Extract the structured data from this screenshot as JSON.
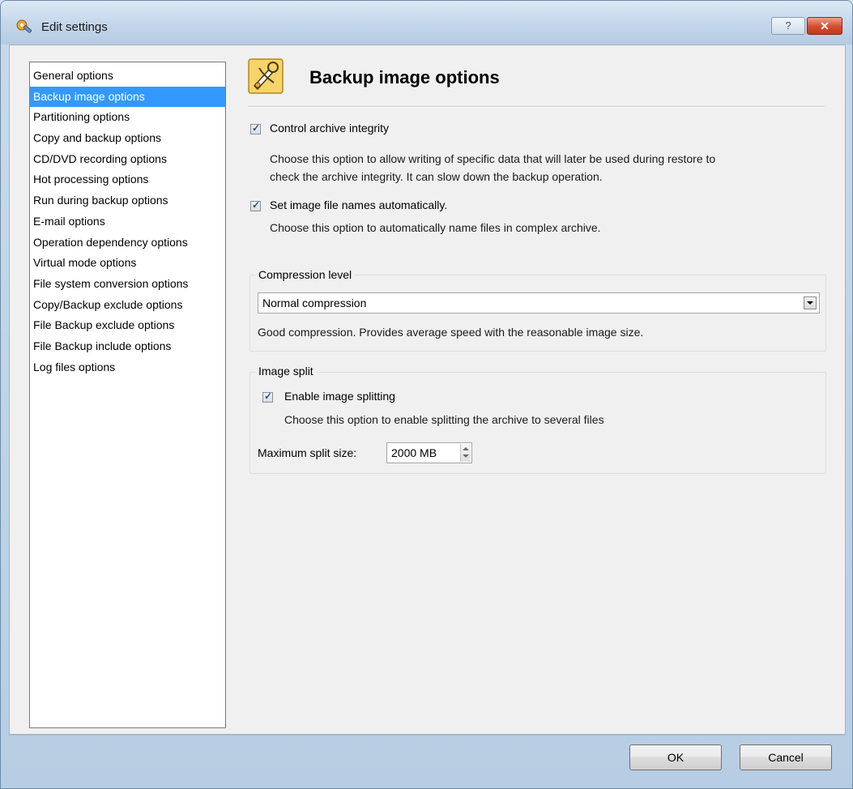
{
  "window": {
    "title": "Edit settings",
    "help_label": "?",
    "close_label": "✕"
  },
  "sidebar": {
    "items": [
      {
        "label": "General options"
      },
      {
        "label": "Backup image options",
        "selected": true
      },
      {
        "label": "Partitioning options"
      },
      {
        "label": "Copy and backup options"
      },
      {
        "label": "CD/DVD recording options"
      },
      {
        "label": "Hot processing options"
      },
      {
        "label": "Run during backup options"
      },
      {
        "label": "E-mail options"
      },
      {
        "label": "Operation dependency options"
      },
      {
        "label": "Virtual mode options"
      },
      {
        "label": "File system conversion options"
      },
      {
        "label": "Copy/Backup exclude options"
      },
      {
        "label": "File Backup exclude options"
      },
      {
        "label": "File Backup include options"
      },
      {
        "label": "Log files options"
      }
    ]
  },
  "main": {
    "title": "Backup image options",
    "control_integrity": {
      "label": "Control archive integrity",
      "checked": true,
      "desc_line1": "Choose this option to allow writing of specific data that will later be used during restore to",
      "desc_line2": "check the archive integrity. It can slow down the backup operation."
    },
    "auto_names": {
      "label": "Set image file names automatically.",
      "checked": true,
      "desc": "Choose this option to automatically name files in complex archive."
    },
    "compression": {
      "group_label": "Compression level",
      "selected": "Normal compression",
      "desc": "Good compression. Provides average speed with the reasonable image size."
    },
    "split": {
      "group_label": "Image split",
      "enable_label": "Enable image splitting",
      "enable_checked": true,
      "desc": "Choose this option to enable splitting the archive to several files",
      "max_label": "Maximum split size:",
      "max_value": "2000 MB"
    }
  },
  "footer": {
    "ok_label": "OK",
    "cancel_label": "Cancel"
  },
  "colors": {
    "selection": "#3399ff",
    "titlebar": "#c3d6ea",
    "dialog_bg": "#f0f0f0"
  }
}
